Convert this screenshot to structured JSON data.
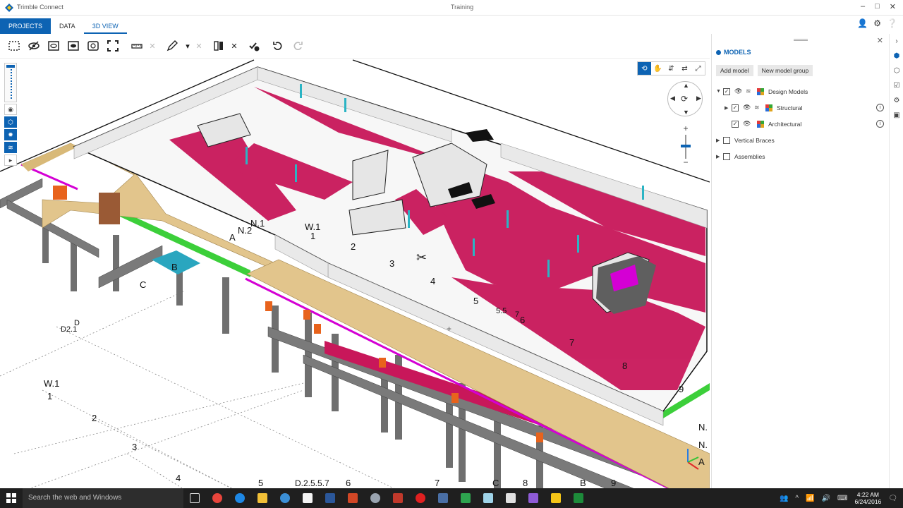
{
  "window": {
    "app_name": "Trimble Connect",
    "title": "Training",
    "controls": [
      "–",
      "□",
      "✕"
    ]
  },
  "nav": {
    "tabs": [
      "PROJECTS",
      "DATA",
      "3D VIEW"
    ],
    "right_icons": [
      "user-icon",
      "gear-icon",
      "help-icon"
    ]
  },
  "toolbar": {
    "tools": [
      "select-box-icon",
      "hide-icon",
      "isolate-icon",
      "show-all-icon",
      "ghost-icon",
      "fit-icon",
      "measure-icon",
      "clear-measure-icon",
      "markup-pen-icon",
      "clear-markup-icon",
      "section-plane-icon",
      "clear-section-icon",
      "create-todo-icon",
      "undo-icon",
      "redo-icon"
    ]
  },
  "viewport": {
    "nav_modes": [
      "orbit-icon",
      "pan-icon",
      "walk-icon",
      "swap-icon",
      "fullscreen-icon"
    ],
    "grid_labels": {
      "a": "A",
      "b": "B",
      "c": "C",
      "n2": "N.2",
      "n1": "N.1",
      "w1": "W.1",
      "one": "1",
      "two": "2",
      "three": "3",
      "four": "4",
      "five": "5",
      "five5": "5.5",
      "seven_s": "7",
      "six": "6",
      "seven": "7",
      "eight": "8",
      "nine": "9",
      "left_d": "D",
      "left_d21": "D2.1",
      "left_w1": "W.1",
      "left_1": "1",
      "left_2": "2",
      "left_3": "3",
      "left_4": "4",
      "bot_5": "5",
      "bot_d": "D.2.5.5.7",
      "bot_6": "6",
      "bot_7": "7",
      "bot_c": "C",
      "bot_8": "8",
      "bot_b": "B",
      "bot_9": "9",
      "right_n1": "N.",
      "right_n2": "N.",
      "right_a": "A"
    }
  },
  "models_panel": {
    "header": "MODELS",
    "buttons": {
      "add_model": "Add model",
      "new_group": "New model group"
    },
    "tree": [
      {
        "label": "Design Models",
        "checked": true,
        "expanded": true,
        "level": 0
      },
      {
        "label": "Structural",
        "checked": true,
        "expanded": false,
        "level": 1
      },
      {
        "label": "Architectural",
        "checked": true,
        "expanded": null,
        "level": 1
      },
      {
        "label": "Vertical Braces",
        "checked": false,
        "expanded": false,
        "level": 0
      },
      {
        "label": "Assemblies",
        "checked": false,
        "expanded": false,
        "level": 0
      }
    ]
  },
  "taskbar": {
    "search_placeholder": "Search the web and Windows",
    "time": "4:22 AM",
    "date": "6/24/2016"
  },
  "colors": {
    "accent": "#0d63b3",
    "wall_red": "#c8175a",
    "timber": "#e2c58c",
    "steel": "#6f6f6f",
    "green": "#3ccf3a",
    "magenta": "#d400d4",
    "teal": "#2bb4c4"
  }
}
